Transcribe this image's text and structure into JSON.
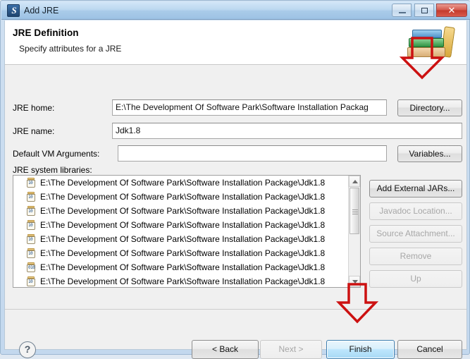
{
  "window": {
    "title": "Add JRE",
    "icon": "jre-wizard-icon",
    "buttons": {
      "minimize": "minimize-icon",
      "maximize": "maximize-icon",
      "close": "close-icon"
    }
  },
  "header": {
    "title": "JRE Definition",
    "subtitle": "Specify attributes for a JRE",
    "icon": "books-icon"
  },
  "form": {
    "jre_home_label": "JRE home:",
    "jre_home_value": "E:\\The Development Of Software Park\\Software Installation Packag",
    "directory_button": "Directory...",
    "jre_name_label": "JRE name:",
    "jre_name_value": "Jdk1.8",
    "vm_args_label": "Default VM Arguments:",
    "vm_args_value": "",
    "vm_args_placeholder": "",
    "variables_button": "Variables...",
    "libraries_label": "JRE system libraries:"
  },
  "libraries": {
    "items": [
      "E:\\The Development Of Software Park\\Software Installation Package\\Jdk1.8",
      "E:\\The Development Of Software Park\\Software Installation Package\\Jdk1.8",
      "E:\\The Development Of Software Park\\Software Installation Package\\Jdk1.8",
      "E:\\The Development Of Software Park\\Software Installation Package\\Jdk1.8",
      "E:\\The Development Of Software Park\\Software Installation Package\\Jdk1.8",
      "E:\\The Development Of Software Park\\Software Installation Package\\Jdk1.8",
      "E:\\The Development Of Software Park\\Software Installation Package\\Jdk1.8",
      "E:\\The Development Of Software Park\\Software Installation Package\\Jdk1.8"
    ],
    "scrollbar": {
      "up_arrow": "scroll-up-icon",
      "down_arrow": "scroll-down-icon"
    }
  },
  "side_buttons": [
    {
      "label": "Add External JARs...",
      "enabled": true
    },
    {
      "label": "Javadoc Location...",
      "enabled": false
    },
    {
      "label": "Source Attachment...",
      "enabled": false
    },
    {
      "label": "Remove",
      "enabled": false
    },
    {
      "label": "Up",
      "enabled": false
    }
  ],
  "footer": {
    "help_icon": "help-icon",
    "back_button": "< Back",
    "next_button": "Next >",
    "finish_button": "Finish",
    "cancel_button": "Cancel"
  },
  "annotations": {
    "arrow_directory": "red-down-arrow-pointing-to-directory-button",
    "arrow_finish": "red-down-arrow-pointing-to-finish-button",
    "color": "#cc1111"
  }
}
